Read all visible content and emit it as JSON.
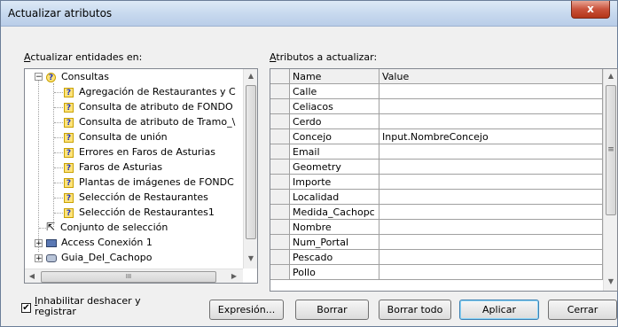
{
  "window": {
    "title": "Actualizar atributos",
    "close_glyph": "x"
  },
  "left": {
    "label_prefix": "A",
    "label_rest": "ctualizar entidades en:",
    "tree": [
      {
        "label": "Consultas",
        "icon": "query-folder-icon"
      },
      {
        "label": "Agregación de Restaurantes y C",
        "icon": "query-icon"
      },
      {
        "label": "Consulta de atributo de FONDO",
        "icon": "query-icon"
      },
      {
        "label": "Consulta de atributo de Tramo_\\",
        "icon": "query-icon"
      },
      {
        "label": "Consulta de unión",
        "icon": "query-icon"
      },
      {
        "label": "Errores en Faros de Asturias",
        "icon": "query-icon"
      },
      {
        "label": "Faros de Asturias",
        "icon": "query-icon"
      },
      {
        "label": "Plantas de imágenes de FONDC",
        "icon": "query-icon"
      },
      {
        "label": "Selección de Restaurantes",
        "icon": "query-icon"
      },
      {
        "label": "Selección de Restaurantes1",
        "icon": "query-icon"
      },
      {
        "label": "Conjunto de selección",
        "icon": "cursor-icon"
      },
      {
        "label": "Access Conexión 1",
        "icon": "connection-icon"
      },
      {
        "label": "Guia_Del_Cachopo",
        "icon": "database-icon"
      }
    ],
    "hscroll_grip": "III"
  },
  "right": {
    "label_prefix": "A",
    "label_rest": "tributos a actualizar:",
    "col_name": "Name",
    "col_value": "Value",
    "rows": [
      {
        "name": "Calle",
        "value": ""
      },
      {
        "name": "Celiacos",
        "value": ""
      },
      {
        "name": "Cerdo",
        "value": ""
      },
      {
        "name": "Concejo",
        "value": "Input.NombreConcejo"
      },
      {
        "name": "Email",
        "value": ""
      },
      {
        "name": "Geometry",
        "value": ""
      },
      {
        "name": "Importe",
        "value": ""
      },
      {
        "name": "Localidad",
        "value": ""
      },
      {
        "name": "Medida_Cachopc",
        "value": ""
      },
      {
        "name": "Nombre",
        "value": ""
      },
      {
        "name": "Num_Portal",
        "value": ""
      },
      {
        "name": "Pescado",
        "value": ""
      },
      {
        "name": "Pollo",
        "value": ""
      }
    ],
    "scroll_grip": "≡"
  },
  "footer": {
    "checkbox_checked": true,
    "checkbox_label_1_prefix": "I",
    "checkbox_label_1_rest": "nhabilitar deshacer y",
    "checkbox_label_2": "registrar",
    "buttons": {
      "expresion": "Expresión...",
      "borrar": "Borrar",
      "borrar_todo": "Borrar todo",
      "aplicar": "Aplicar",
      "cerrar": "Cerrar"
    }
  }
}
